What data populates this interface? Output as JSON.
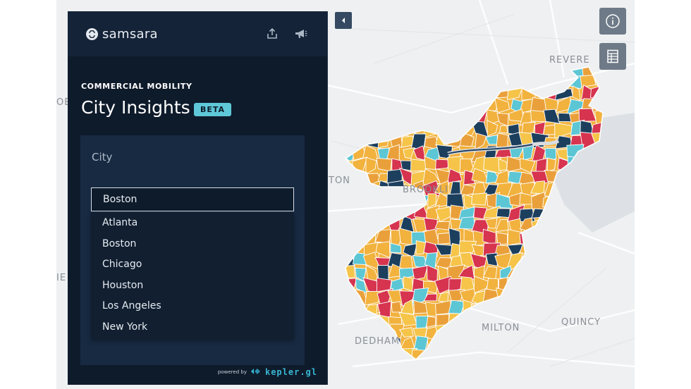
{
  "brand": {
    "name": "samsara"
  },
  "header": {
    "share_icon": "share-icon",
    "feedback_icon": "megaphone-icon"
  },
  "panel": {
    "eyebrow": "COMMERCIAL MOBILITY",
    "title": "City Insights",
    "badge": "BETA",
    "city_label": "City",
    "selected_city": "Boston",
    "city_options": [
      "Atlanta",
      "Boston",
      "Chicago",
      "Houston",
      "Los Angeles",
      "New York"
    ]
  },
  "footer": {
    "powered_by": "powered by",
    "kepler": "kepler.gl"
  },
  "map": {
    "labels": [
      "REVERE",
      "BROOKLI",
      "TON",
      "MILTON",
      "QUINCY",
      "DEDHAM",
      "OB",
      "IE"
    ],
    "colors": {
      "gold": "#f2b23e",
      "yellow": "#f5c449",
      "orange": "#eaa03a",
      "red": "#d6344f",
      "teal": "#5cc6d4",
      "navy": "#1d3f5e",
      "land": "#eef0f2",
      "water": "#d9dde1"
    }
  },
  "controls": {
    "info_icon": "info-icon",
    "legend_icon": "table-icon",
    "collapse_icon": "chevron-left-icon"
  }
}
